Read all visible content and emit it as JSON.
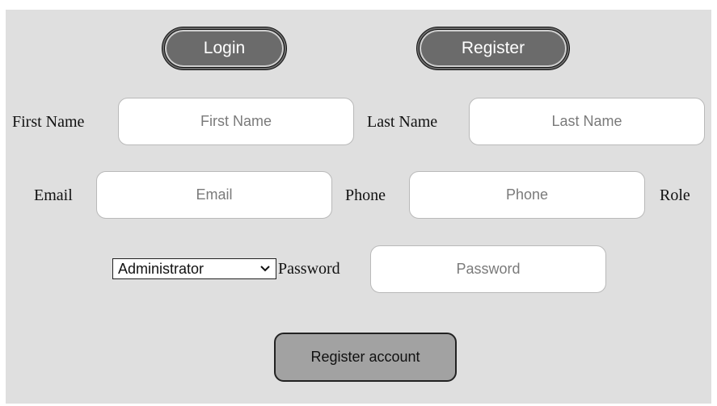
{
  "tabs": {
    "login_label": "Login",
    "register_label": "Register"
  },
  "form": {
    "first_name": {
      "label": "First Name",
      "placeholder": "First Name"
    },
    "last_name": {
      "label": "Last Name",
      "placeholder": "Last Name"
    },
    "email": {
      "label": "Email",
      "placeholder": "Email"
    },
    "phone": {
      "label": "Phone",
      "placeholder": "Phone"
    },
    "role": {
      "label": "Role",
      "selected": "Administrator"
    },
    "password": {
      "label": "Password",
      "placeholder": "Password"
    },
    "submit_label": "Register account"
  },
  "icons": {
    "role_dropdown": "chevron-down-icon"
  }
}
